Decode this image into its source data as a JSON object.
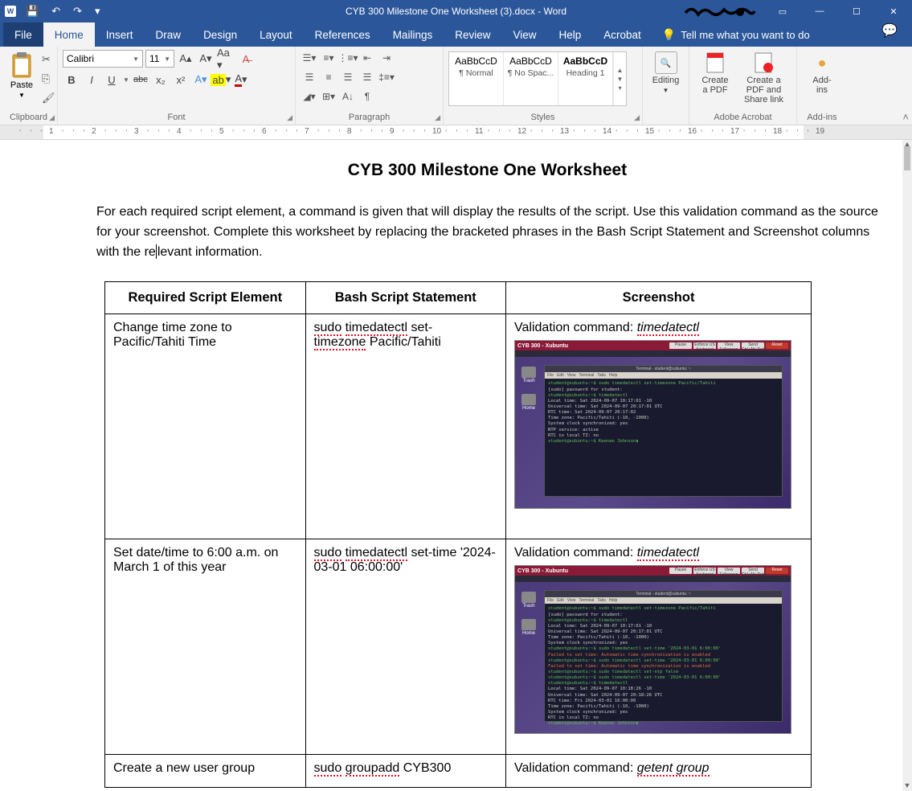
{
  "titlebar": {
    "doc_title": "CYB 300 Milestone One Worksheet (3).docx  -  Word"
  },
  "qat": {
    "save": "💾",
    "undo": "↶",
    "redo": "↷",
    "more": "▾"
  },
  "window_controls": {
    "ribbon_opts": "▭",
    "min": "—",
    "max": "☐",
    "close": "✕"
  },
  "tabs": {
    "file": "File",
    "home": "Home",
    "insert": "Insert",
    "draw": "Draw",
    "design": "Design",
    "layout": "Layout",
    "references": "References",
    "mailings": "Mailings",
    "review": "Review",
    "view": "View",
    "help": "Help",
    "acrobat": "Acrobat",
    "tell_me": "Tell me what you want to do"
  },
  "ribbon": {
    "clipboard": {
      "label": "Clipboard",
      "paste": "Paste"
    },
    "font": {
      "label": "Font",
      "name": "Calibri",
      "size": "11",
      "bold": "B",
      "italic": "I",
      "underline": "U",
      "strike": "abc",
      "sub": "x₂",
      "sup": "x²",
      "grow": "A▴",
      "shrink": "A▾",
      "case": "Aa ▾",
      "clear": "A⁻",
      "highlight": "ab ▾",
      "color": "A ▾",
      "effects": "A ▾"
    },
    "paragraph": {
      "label": "Paragraph"
    },
    "styles": {
      "label": "Styles",
      "items": [
        {
          "preview": "AaBbCcD",
          "name": "¶ Normal"
        },
        {
          "preview": "AaBbCcD",
          "name": "¶ No Spac..."
        },
        {
          "preview": "AaBbCcD",
          "name": "Heading 1"
        }
      ]
    },
    "editing": {
      "label": "Editing",
      "find": "Editing"
    },
    "acrobat": {
      "label": "Adobe Acrobat",
      "create_pdf": "Create a PDF",
      "share": "Create a PDF and Share link"
    },
    "addins": {
      "label": "Add-ins",
      "btn": "Add-ins"
    }
  },
  "ruler": {
    "numbers": [
      1,
      2,
      3,
      4,
      5,
      6,
      7,
      8,
      9,
      10,
      11,
      12,
      13,
      14,
      15,
      16,
      17,
      18,
      19
    ]
  },
  "document": {
    "title": "CYB 300 Milestone One Worksheet",
    "intro_1": "For each required script element, a command is given that will display the results of the script. Use this validation command as the source for your screenshot. Complete this worksheet by replacing the bracketed phrases in the Bash Script Statement and Screenshot columns with the re",
    "intro_2": "levant information.",
    "th1": "Required Script Element",
    "th2": "Bash Script Statement",
    "th3": "Screenshot",
    "rows": [
      {
        "req": "Change time zone to Pacific/Tahiti Time",
        "bash_p1": "sudo",
        "bash_p2": "timedatectl",
        "bash_p3": " set-",
        "bash_p4": "timezone",
        "bash_p5": " Pacific/Tahiti",
        "val_label": "Validation command: ",
        "val_cmd": "timedatectl"
      },
      {
        "req": "Set date/time to 6:00 a.m. on March 1 of this year",
        "bash_p1": "sudo",
        "bash_p2": "timedatectl",
        "bash_p3": " set-time '2024-03-01 06:00:00'",
        "val_label": "Validation command: ",
        "val_cmd": "timedatectl"
      },
      {
        "req": "Create a new user group",
        "bash_p1": "sudo",
        "bash_p2": "groupadd",
        "bash_p3": " CYB300",
        "val_label": "Validation command: ",
        "val_cmd": "getent group"
      }
    ],
    "embed": {
      "vm_title": "CYB 300 - Xubuntu",
      "btns": [
        "Pause",
        "Enforce US Keyboard Layout",
        "View Fullscreen",
        "Send Ctrl+Alt+Delete",
        "Reset"
      ],
      "desk_icons": [
        "Trash",
        "Home"
      ],
      "term_menu": [
        "File",
        "Edit",
        "View",
        "Terminal",
        "Tabs",
        "Help"
      ],
      "term_title": "Terminal - student@xubuntu: ~",
      "lines1": [
        {
          "c": "g",
          "t": "student@xubuntu:~$ sudo timedatectl set-timezone Pacific/Tahiti"
        },
        {
          "c": "w",
          "t": "[sudo] password for student:"
        },
        {
          "c": "g",
          "t": "student@xubuntu:~$ timedatectl"
        },
        {
          "c": "w",
          "t": "               Local time: Sat 2024-09-07 10:17:01 -10"
        },
        {
          "c": "w",
          "t": "           Universal time: Sat 2024-09-07 20:17:01 UTC"
        },
        {
          "c": "w",
          "t": "                 RTC time: Sat 2024-09-07 20:17:02"
        },
        {
          "c": "w",
          "t": "                Time zone: Pacific/Tahiti (-10, -1000)"
        },
        {
          "c": "w",
          "t": "System clock synchronized: yes"
        },
        {
          "c": "w",
          "t": "              NTP service: active"
        },
        {
          "c": "w",
          "t": "          RTC in local TZ: no"
        },
        {
          "c": "g",
          "t": "student@xubuntu:~$ Keenan Johnson▮"
        }
      ],
      "lines2": [
        {
          "c": "g",
          "t": "student@xubuntu:~$ sudo timedatectl set-timezone Pacific/Tahiti"
        },
        {
          "c": "w",
          "t": "[sudo] password for student:"
        },
        {
          "c": "g",
          "t": "student@xubuntu:~$ timedatectl"
        },
        {
          "c": "w",
          "t": "               Local time: Sat 2024-09-07 10:17:01 -10"
        },
        {
          "c": "w",
          "t": "           Universal time: Sat 2024-09-07 20:17:01 UTC"
        },
        {
          "c": "w",
          "t": "                Time zone: Pacific/Tahiti (-10, -1000)"
        },
        {
          "c": "w",
          "t": "System clock synchronized: yes"
        },
        {
          "c": "g",
          "t": "student@xubuntu:~$ sudo timedatectl set-time '2024-03-01 6:00:00'"
        },
        {
          "c": "r",
          "t": "Failed to set time: Automatic time synchronization is enabled"
        },
        {
          "c": "g",
          "t": "student@xubuntu:~$ sudo timedatectl set-time '2024-03-01 6:00:00'"
        },
        {
          "c": "r",
          "t": "Failed to set time: Automatic time synchronization is enabled"
        },
        {
          "c": "g",
          "t": "student@xubuntu:~$ sudo timedatectl set-ntp false"
        },
        {
          "c": "g",
          "t": "student@xubuntu:~$ sudo timedatectl set-time '2024-03-01 6:00:00'"
        },
        {
          "c": "g",
          "t": "student@xubuntu:~$ timedatectl"
        },
        {
          "c": "w",
          "t": "               Local time: Sat 2024-09-07 10:18:26 -10"
        },
        {
          "c": "w",
          "t": "           Universal time: Sat 2024-09-07 20:18:26 UTC"
        },
        {
          "c": "w",
          "t": "                 RTC time: Fri 2024-03-01 16:00:00"
        },
        {
          "c": "w",
          "t": "                Time zone: Pacific/Tahiti (-10, -1000)"
        },
        {
          "c": "w",
          "t": "System clock synchronized: yes"
        },
        {
          "c": "w",
          "t": "          RTC in local TZ: no"
        },
        {
          "c": "g",
          "t": "student@xubuntu:~$ Keenan Johnson▮"
        }
      ]
    }
  }
}
